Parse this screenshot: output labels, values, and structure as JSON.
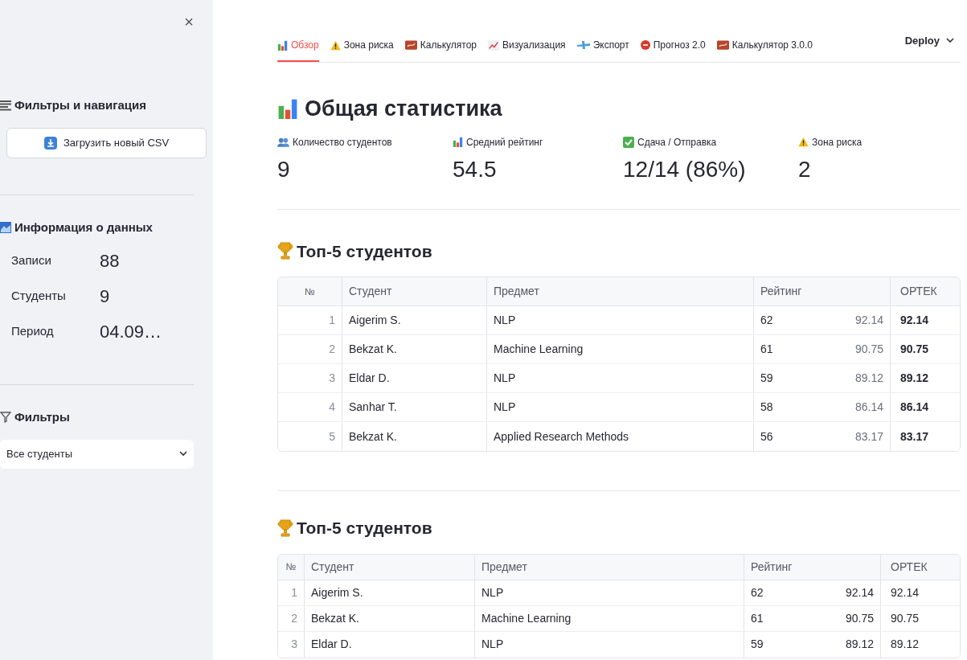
{
  "sidebar": {
    "close": "×",
    "nav_title": "Фильтры и навигация",
    "upload_button": "Загрузить новый CSV",
    "info_title": "Информация о данных",
    "info_rows": [
      {
        "label": "Записи",
        "value": "88"
      },
      {
        "label": "Студенты",
        "value": "9"
      },
      {
        "label": "Период",
        "value": "04.09…"
      }
    ],
    "filters_title": "Фильтры",
    "filter_select": {
      "value": "Все студенты"
    }
  },
  "tabs": [
    {
      "label": "Обзор",
      "selected": true
    },
    {
      "label": "Зона риска",
      "selected": false
    },
    {
      "label": "Калькулятор",
      "selected": false
    },
    {
      "label": "Визуализация",
      "selected": false
    },
    {
      "label": "Экспорт",
      "selected": false
    },
    {
      "label": "Прогноз 2.0",
      "selected": false
    },
    {
      "label": "Калькулятор 3.0.0",
      "selected": false
    }
  ],
  "deploy": "Deploy",
  "stats_title": "Общая статистика",
  "metrics": [
    {
      "label": "Количество студентов",
      "value": "9"
    },
    {
      "label": "Средний рейтинг",
      "value": "54.5"
    },
    {
      "label": "Сдача / Отправка",
      "value": "12/14 (86%)"
    },
    {
      "label": "Зона риска",
      "value": "2"
    }
  ],
  "tables": [
    {
      "title": "Топ-5 студентов",
      "compact": false,
      "bold_total": true,
      "columns": [
        "№",
        "Студент",
        "Предмет",
        "Рейтинг",
        "ОРТЕК"
      ],
      "rows": [
        [
          "1",
          "Aigerim S.",
          "NLP",
          {
            "rating": "62",
            "score": "92.14"
          },
          "92.14"
        ],
        [
          "2",
          "Bekzat K.",
          "Machine Learning",
          {
            "rating": "61",
            "score": "90.75"
          },
          "90.75"
        ],
        [
          "3",
          "Eldar D.",
          "NLP",
          {
            "rating": "59",
            "score": "89.12"
          },
          "89.12"
        ],
        [
          "4",
          "Sanhar T.",
          "NLP",
          {
            "rating": "58",
            "score": "86.14"
          },
          "86.14"
        ],
        [
          "5",
          "Bekzat K.",
          "Applied Research Methods",
          {
            "rating": "56",
            "score": "83.17"
          },
          "83.17"
        ]
      ]
    },
    {
      "title": "Топ-5 студентов",
      "compact": true,
      "bold_total": false,
      "columns": [
        "№",
        "Студент",
        "Предмет",
        "Рейтинг",
        "ОРТЕК"
      ],
      "rows": [
        [
          "1",
          "Aigerim S.",
          "NLP",
          {
            "rating": "62",
            "score": "92.14"
          },
          "92.14"
        ],
        [
          "2",
          "Bekzat K.",
          "Machine Learning",
          {
            "rating": "61",
            "score": "90.75"
          },
          "90.75"
        ],
        [
          "3",
          "Eldar D.",
          "NLP",
          {
            "rating": "59",
            "score": "89.12"
          },
          "89.12"
        ]
      ]
    }
  ]
}
